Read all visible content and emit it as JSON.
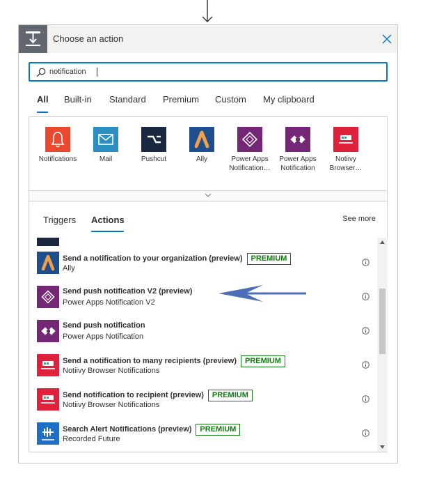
{
  "dialog": {
    "title": "Choose an action"
  },
  "search": {
    "value": "notification",
    "placeholder": ""
  },
  "tabs": [
    {
      "label": "All",
      "active": true
    },
    {
      "label": "Built-in",
      "active": false
    },
    {
      "label": "Standard",
      "active": false
    },
    {
      "label": "Premium",
      "active": false
    },
    {
      "label": "Custom",
      "active": false
    },
    {
      "label": "My clipboard",
      "active": false
    }
  ],
  "connectors": [
    {
      "label": "Notifications",
      "color": "#e8492f",
      "icon": "bell-icon"
    },
    {
      "label": "Mail",
      "color": "#2a8fbf",
      "icon": "mail-icon"
    },
    {
      "label": "Pushcut",
      "color": "#1a2740",
      "icon": "pushcut-icon"
    },
    {
      "label": "Ally",
      "color": "#1f4e8c",
      "icon": "ally-icon"
    },
    {
      "label": "Power Apps Notification…",
      "color": "#742774",
      "icon": "power-apps-icon"
    },
    {
      "label": "Power Apps Notification",
      "color": "#742774",
      "icon": "power-apps-icon"
    },
    {
      "label": "Notiivy Browser…",
      "color": "#e0213c",
      "icon": "notiivy-icon"
    }
  ],
  "sub_tabs": {
    "triggers": "Triggers",
    "actions": "Actions",
    "see_more": "See more"
  },
  "actions": [
    {
      "title": "Send a notification to your organization (preview)",
      "connector": "Ally",
      "premium": "PREMIUM",
      "color": "#1f4e8c",
      "icon": "ally-icon"
    },
    {
      "title": "Send push notification V2 (preview)",
      "connector": "Power Apps Notification V2",
      "premium": "",
      "color": "#742774",
      "icon": "power-apps-icon"
    },
    {
      "title": "Send push notification",
      "connector": "Power Apps Notification",
      "premium": "",
      "color": "#742774",
      "icon": "power-apps-icon"
    },
    {
      "title": "Send a notification to many recipients (preview)",
      "connector": "Notiivy Browser Notifications",
      "premium": "PREMIUM",
      "color": "#e0213c",
      "icon": "notiivy-icon"
    },
    {
      "title": "Send notification to recipient (preview)",
      "connector": "Notiivy Browser Notifications",
      "premium": "PREMIUM",
      "color": "#e0213c",
      "icon": "notiivy-icon"
    },
    {
      "title": "Search Alert Notifications (preview)",
      "connector": "Recorded Future",
      "premium": "PREMIUM",
      "color": "#1f6fc4",
      "icon": "recorded-future-icon"
    }
  ],
  "colors": {
    "accent": "#0078d4",
    "premium": "#107c10",
    "annotation_arrow": "#4a6fb8"
  }
}
